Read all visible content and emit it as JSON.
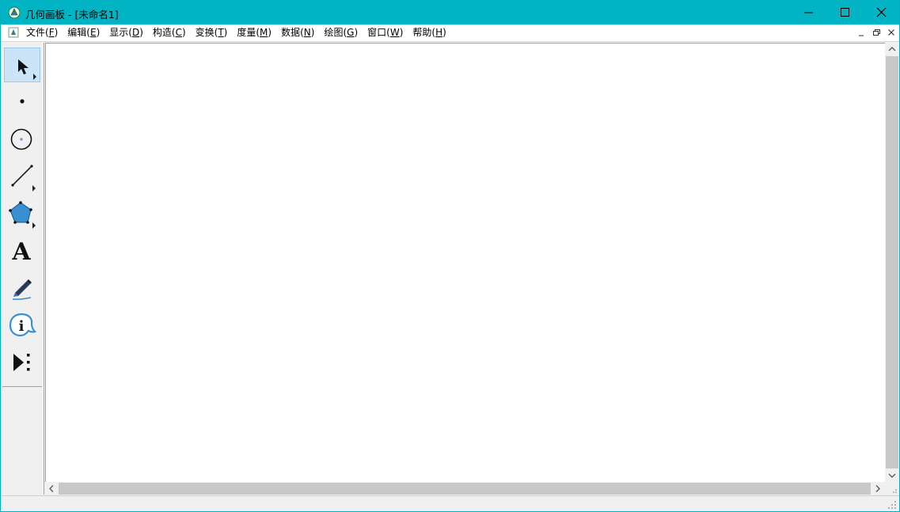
{
  "window": {
    "title": "几何画板 - [未命名1]"
  },
  "menu": {
    "items": [
      {
        "label": "文件(",
        "accel": "F",
        "close": ")"
      },
      {
        "label": "编辑(",
        "accel": "E",
        "close": ")"
      },
      {
        "label": "显示(",
        "accel": "D",
        "close": ")"
      },
      {
        "label": "构造(",
        "accel": "C",
        "close": ")"
      },
      {
        "label": "变换(",
        "accel": "T",
        "close": ")"
      },
      {
        "label": "度量(",
        "accel": "M",
        "close": ")"
      },
      {
        "label": "数据(",
        "accel": "N",
        "close": ")"
      },
      {
        "label": "绘图(",
        "accel": "G",
        "close": ")"
      },
      {
        "label": "窗口(",
        "accel": "W",
        "close": ")"
      },
      {
        "label": "帮助(",
        "accel": "H",
        "close": ")"
      }
    ]
  },
  "toolbox": {
    "tools": [
      {
        "name": "selection-arrow-tool",
        "selected": true,
        "icon": "arrow-icon"
      },
      {
        "name": "point-tool",
        "selected": false,
        "icon": "point-icon"
      },
      {
        "name": "compass-tool",
        "selected": false,
        "icon": "circle-icon"
      },
      {
        "name": "straightedge-tool",
        "selected": false,
        "icon": "segment-icon"
      },
      {
        "name": "polygon-tool",
        "selected": false,
        "icon": "polygon-icon"
      },
      {
        "name": "text-tool",
        "selected": false,
        "icon": "text-icon",
        "glyph": "A"
      },
      {
        "name": "marker-tool",
        "selected": false,
        "icon": "marker-pen-icon"
      },
      {
        "name": "information-tool",
        "selected": false,
        "icon": "info-icon",
        "glyph": "i"
      },
      {
        "name": "custom-tool",
        "selected": false,
        "icon": "custom-tool-icon"
      }
    ]
  },
  "colors": {
    "titlebar": "#00b4c4",
    "selected_tool": "#cce4f7",
    "polygon_fill": "#3a8fd0",
    "info_blue": "#3a8fd0"
  }
}
